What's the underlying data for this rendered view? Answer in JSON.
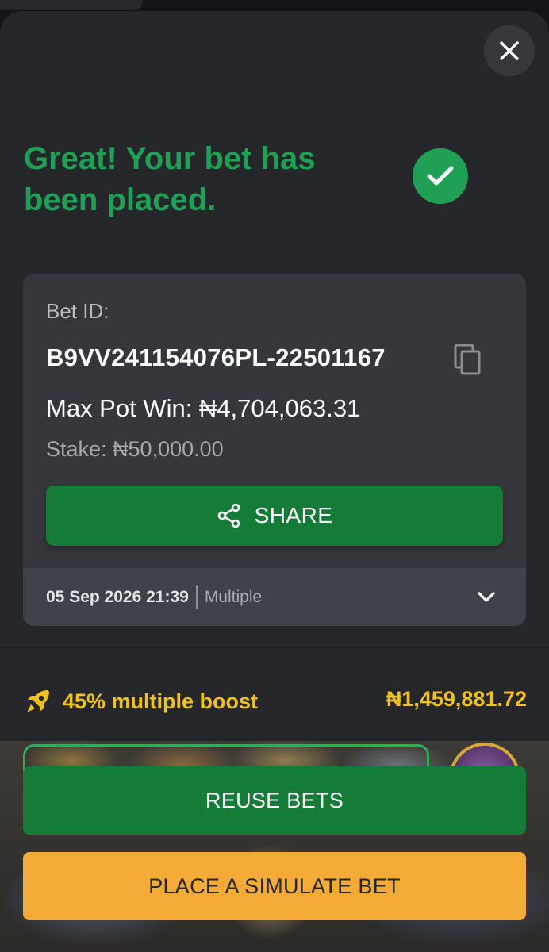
{
  "header": {
    "close_icon": "close-icon",
    "success_title": "Great! Your bet has been placed.",
    "success_icon": "check-circle-icon",
    "success_color": "#1fa055"
  },
  "bet": {
    "id_label": "Bet ID:",
    "id_value": "B9VV241154076PL-22501167",
    "copy_icon": "copy-icon",
    "max_pot_win": "Max Pot Win: ₦4,704,063.31",
    "stake": "Stake: ₦50,000.00",
    "share_label": "SHARE",
    "share_icon": "share-icon",
    "datetime": "05 Sep 2026 21:39",
    "bet_type": "Multiple",
    "expand_icon": "chevron-down-icon"
  },
  "boost": {
    "icon": "rocket-icon",
    "label": "45% multiple boost",
    "amount": "₦1,459,881.72",
    "color": "#f1c21b"
  },
  "actions": {
    "reuse_label": "REUSE BETS",
    "simulate_label": "PLACE A SIMULATE BET",
    "primary_color": "#157c38",
    "secondary_color": "#f3aa36"
  }
}
